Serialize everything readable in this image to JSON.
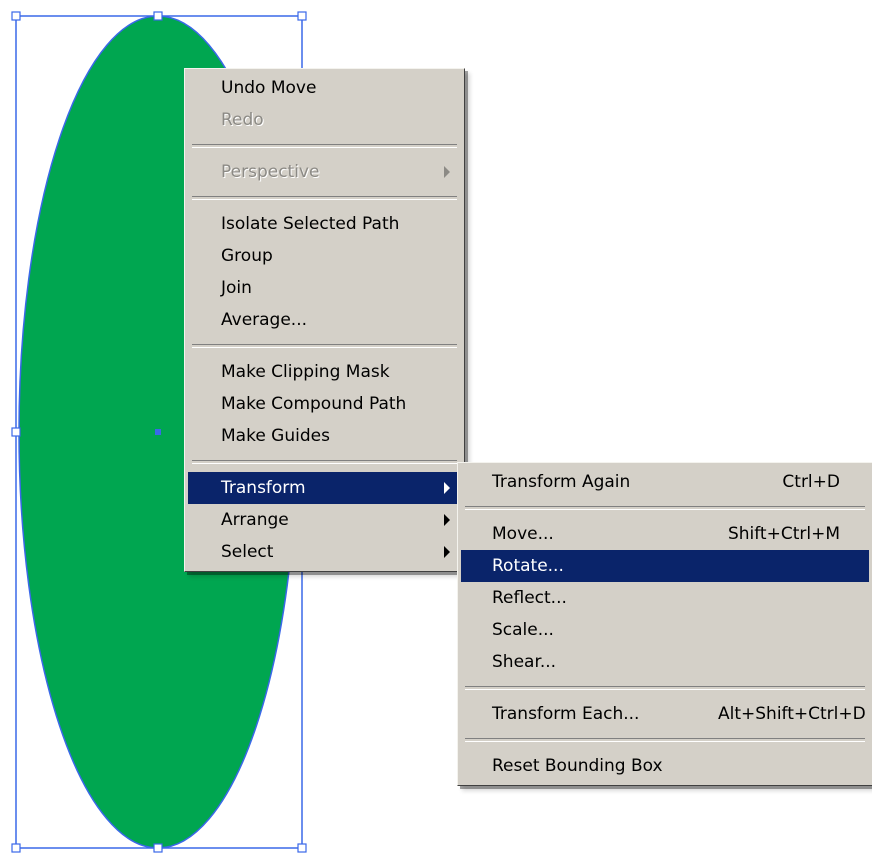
{
  "canvas": {
    "shape_fill": "#00a650",
    "selection_color": "#3a68e8"
  },
  "context_menu": {
    "group1": [
      {
        "label": "Undo Move",
        "disabled": false
      },
      {
        "label": "Redo",
        "disabled": true
      }
    ],
    "group2": [
      {
        "label": "Perspective",
        "disabled": true,
        "submenu": true
      }
    ],
    "group3": [
      {
        "label": "Isolate Selected Path"
      },
      {
        "label": "Group"
      },
      {
        "label": "Join"
      },
      {
        "label": "Average..."
      }
    ],
    "group4": [
      {
        "label": "Make Clipping Mask"
      },
      {
        "label": "Make Compound Path"
      },
      {
        "label": "Make Guides"
      }
    ],
    "group5": [
      {
        "label": "Transform",
        "highlighted": true,
        "submenu": true
      },
      {
        "label": "Arrange",
        "submenu": true
      },
      {
        "label": "Select",
        "submenu": true
      }
    ]
  },
  "transform_submenu": {
    "group1": [
      {
        "label": "Transform Again",
        "shortcut": "Ctrl+D"
      }
    ],
    "group2": [
      {
        "label": "Move...",
        "shortcut": "Shift+Ctrl+M"
      },
      {
        "label": "Rotate...",
        "shortcut": "",
        "highlighted": true
      },
      {
        "label": "Reflect...",
        "shortcut": ""
      },
      {
        "label": "Scale...",
        "shortcut": ""
      },
      {
        "label": "Shear...",
        "shortcut": ""
      }
    ],
    "group3": [
      {
        "label": "Transform Each...",
        "shortcut": "Alt+Shift+Ctrl+D"
      }
    ],
    "group4": [
      {
        "label": "Reset Bounding Box",
        "shortcut": ""
      }
    ]
  }
}
